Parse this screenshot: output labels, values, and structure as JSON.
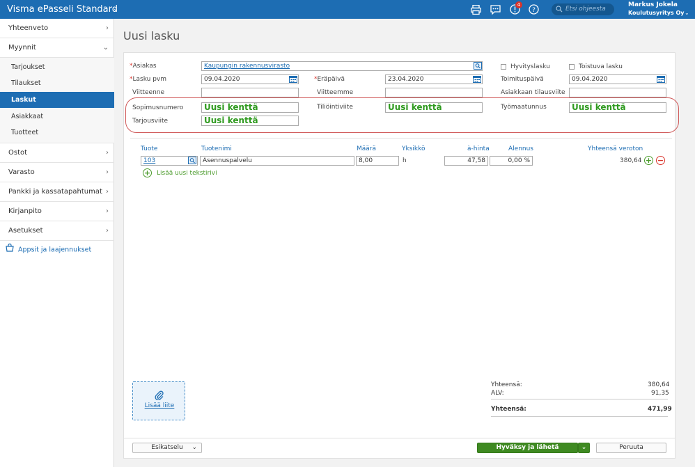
{
  "app": {
    "title": "Visma ePasseli Standard"
  },
  "topbar": {
    "notification_count": "4",
    "search_placeholder": "Etsi ohjeesta",
    "user_name": "Markus Jokela",
    "user_company": "Koulutusyritys Oy"
  },
  "sidebar": {
    "items": [
      {
        "label": "Yhteenveto"
      },
      {
        "label": "Myynnit"
      },
      {
        "label": "Ostot"
      },
      {
        "label": "Varasto"
      },
      {
        "label": "Pankki ja kassatapahtumat"
      },
      {
        "label": "Kirjanpito"
      },
      {
        "label": "Asetukset"
      }
    ],
    "sales_sub": [
      {
        "label": "Tarjoukset"
      },
      {
        "label": "Tilaukset"
      },
      {
        "label": "Laskut"
      },
      {
        "label": "Asiakkaat"
      },
      {
        "label": "Tuotteet"
      }
    ],
    "apps_label": "Appsit ja laajennukset"
  },
  "page": {
    "title": "Uusi lasku"
  },
  "form": {
    "customer": {
      "label": "Asiakas",
      "value": "Kaupungin rakennusvirasto"
    },
    "credit_note": {
      "label": "Hyvityslasku"
    },
    "recurring": {
      "label": "Toistuva lasku"
    },
    "invoice_date": {
      "label": "Lasku pvm",
      "value": "09.04.2020"
    },
    "due_date": {
      "label": "Eräpäivä",
      "value": "23.04.2020"
    },
    "delivery_date": {
      "label": "Toimituspäivä",
      "value": "09.04.2020"
    },
    "your_reference": {
      "label": "Viitteenne",
      "value": ""
    },
    "our_reference": {
      "label": "Viitteemme",
      "value": ""
    },
    "customer_order_ref": {
      "label": "Asiakkaan tilausviite",
      "value": ""
    },
    "contract_number": {
      "label": "Sopimusnumero",
      "value": "Uusi kenttä"
    },
    "account_reference": {
      "label": "Tiliöintiviite",
      "value": "Uusi kenttä"
    },
    "worksite_id": {
      "label": "Työmaatunnus",
      "value": "Uusi kenttä"
    },
    "offer_reference": {
      "label": "Tarjousviite",
      "value": "Uusi kenttä"
    }
  },
  "rows": {
    "headers": {
      "product": "Tuote",
      "product_name": "Tuotenimi",
      "quantity": "Määrä",
      "unit": "Yksikkö",
      "unit_price": "à-hinta",
      "discount": "Alennus",
      "total_ex_vat": "Yhteensä veroton"
    },
    "items": [
      {
        "product": "103",
        "product_name": "Asennuspalvelu",
        "quantity": "8,00",
        "unit": "h",
        "unit_price": "47,58",
        "discount": "0,00 %",
        "total": "380,64"
      }
    ],
    "add_text_row": "Lisää uusi tekstirivi"
  },
  "attachment": {
    "label": "Lisää liite"
  },
  "totals": {
    "subtotal_label": "Yhteensä:",
    "subtotal": "380,64",
    "vat_label": "ALV:",
    "vat": "91,35",
    "total_label": "Yhteensä:",
    "total": "471,99"
  },
  "footer": {
    "preview": "Esikatselu",
    "approve_send": "Hyväksy ja lähetä verkkolaskuna",
    "cancel": "Peruuta"
  }
}
